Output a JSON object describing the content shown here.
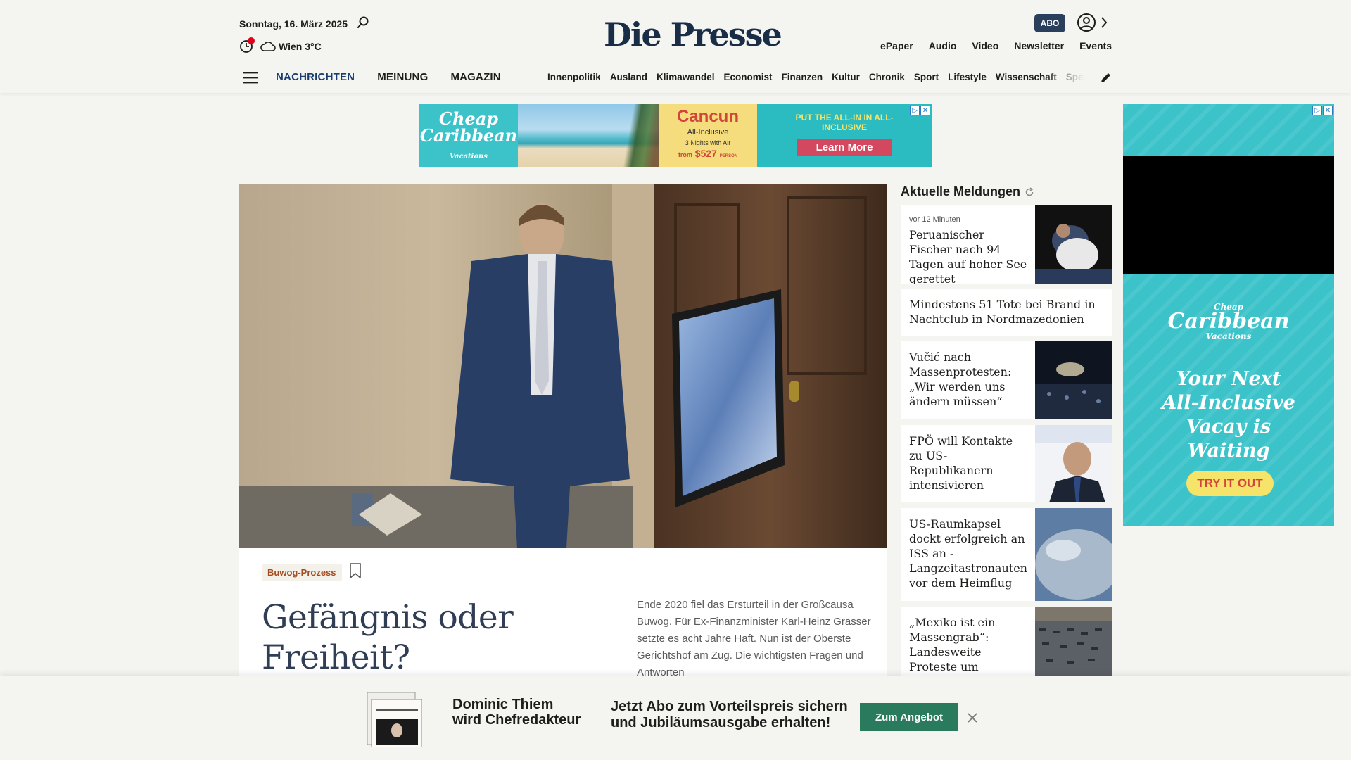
{
  "header": {
    "date": "Sonntag, 16. März 2025",
    "weather": "Wien 3°C",
    "logo": "Die Presse",
    "abo_label": "ABO",
    "top_links": [
      "ePaper",
      "Audio",
      "Video",
      "Newsletter",
      "Events"
    ],
    "main_nav": [
      {
        "label": "NACHRICHTEN",
        "active": true
      },
      {
        "label": "MEINUNG",
        "active": false
      },
      {
        "label": "MAGAZIN",
        "active": false
      }
    ],
    "sub_nav": [
      "Innenpolitik",
      "Ausland",
      "Klimawandel",
      "Economist",
      "Finanzen",
      "Kultur",
      "Chronik",
      "Sport",
      "Lifestyle",
      "Wissenschaft",
      "Spectrum"
    ]
  },
  "ad_banner": {
    "brand": "Cheap Caribbean",
    "brand_sub": "Vacations",
    "destination": "Cancun",
    "package": "All-Inclusive",
    "nights": "3 Nights with Air",
    "price_prefix": "from",
    "price": "$527",
    "price_suffix": "PERSON",
    "slogan": "PUT THE ALL-IN IN ALL-INCLUSIVE",
    "cta": "Learn More"
  },
  "side_ad": {
    "brand_top": "Cheap",
    "brand": "Caribbean",
    "brand_sub": "Vacations",
    "headline": "Your Next All-Inclusive Vacay is Waiting",
    "cta": "TRY IT OUT"
  },
  "hero": {
    "tag": "Buwog-Prozess",
    "title": "Gefängnis oder Freiheit? Schicksalstage",
    "teaser": "Ende 2020 fiel das Ersturteil in der Großcausa Buwog. Für Ex-Finanzminister Karl-Heinz Grasser setzte es acht Jahre Haft. Nun ist der Oberste Gerichtshof am Zug. Die wichtigsten Fragen und Antworten"
  },
  "news": {
    "heading": "Aktuelle Meldungen",
    "items": [
      {
        "time": "vor 12 Minuten",
        "title": "Peruanischer Fischer nach 94 Tagen auf hoher See gerettet"
      },
      {
        "time": "",
        "title": "Mindestens 51 Tote bei Brand in Nachtclub in Nordmazedonien"
      },
      {
        "time": "",
        "title": "Vučić nach Massenprotesten: „Wir werden uns ändern müssen“"
      },
      {
        "time": "",
        "title": "FPÖ will Kontakte zu US-Republikanern intensivieren"
      },
      {
        "time": "",
        "title": "US-Raumkapsel dockt erfolgreich an ISS an - Langzeitastronauten vor dem Heimflug"
      },
      {
        "time": "",
        "title": "„Mexiko ist ein Massengrab“: Landesweite Proteste um Vermisste"
      }
    ]
  },
  "promo": {
    "line1": "Dominic Thiem",
    "line2": "wird Chefredakteur",
    "offer1": "Jetzt Abo zum Vorteilspreis sichern",
    "offer2": "und Jubiläumsausgabe erhalten!",
    "cta": "Zum Angebot"
  },
  "colors": {
    "brand_navy": "#1a2d47",
    "accent_green": "#2a7a5e",
    "tag_orange": "#a64b1d",
    "ad_teal": "#2bbcc2"
  }
}
